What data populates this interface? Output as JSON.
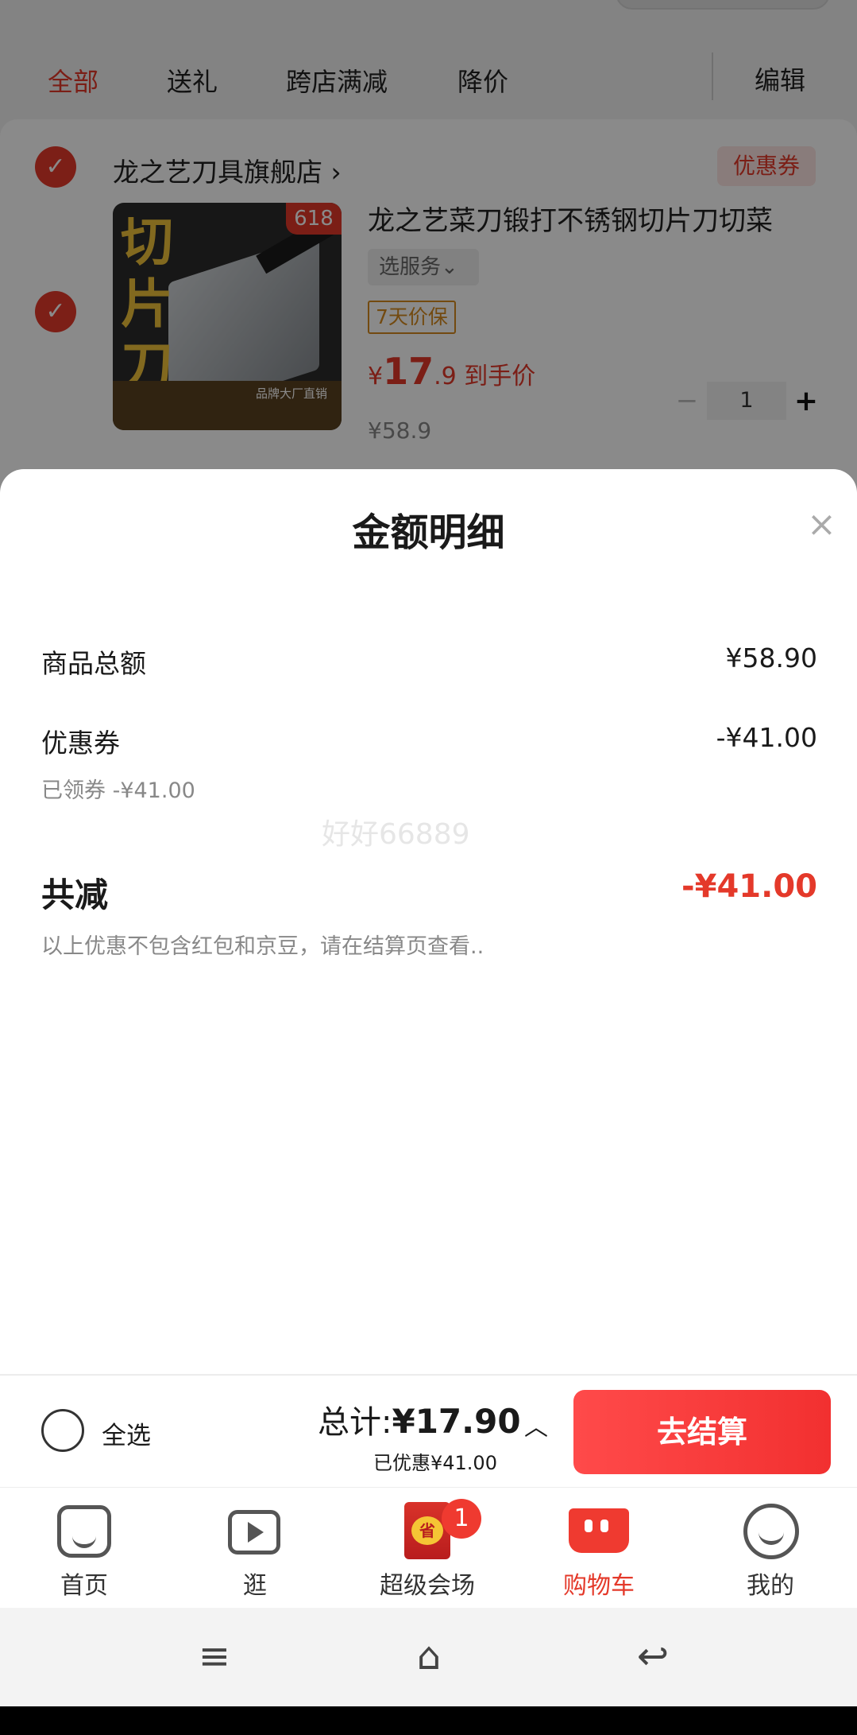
{
  "filters": {
    "tabs": [
      "全部",
      "送礼",
      "跨店满减",
      "降价"
    ],
    "edit_label": "编辑"
  },
  "shop": {
    "name": "龙之艺刀具旗舰店 ›",
    "coupon_tag": "优惠券"
  },
  "product": {
    "title": "龙之艺菜刀锻打不锈钢切片刀切菜",
    "image_badge": "618",
    "image_text": "切片刀",
    "image_strip": "品牌大厂直销",
    "service_select": "选服务⌄",
    "warranty_tag": "7天价保",
    "price_symbol": "¥",
    "price_int": "17",
    "price_dec": ".9",
    "price_suffix": "到手价",
    "original_price": "¥58.9",
    "quantity": "1",
    "minus": "−",
    "plus": "+"
  },
  "sheet": {
    "title": "金额明细",
    "close": "×",
    "goods_total_label": "商品总额",
    "goods_total_value": "¥58.90",
    "coupon_label": "优惠券",
    "coupon_value": "-¥41.00",
    "coupon_note": "已领券 -¥41.00",
    "watermark": "好好66889",
    "total_reduce_label": "共减",
    "total_reduce_value": "-¥41.00",
    "disclaimer": "以上优惠不包含红包和京豆，请在结算页查看.."
  },
  "checkout": {
    "select_all": "全选",
    "total_prefix": "总计:",
    "total_value": "¥17.90",
    "saved": "已优惠¥41.00",
    "chevron": "︿",
    "go_button": "去结算"
  },
  "tabbar": {
    "items": [
      {
        "label": "首页"
      },
      {
        "label": "逛"
      },
      {
        "label": "超级会场",
        "badge": "1"
      },
      {
        "label": "购物车"
      },
      {
        "label": "我的"
      }
    ],
    "active_color": "#e4392a"
  },
  "sysnav": {
    "menu": "≡",
    "home": "⌂",
    "back": "↩"
  },
  "colors": {
    "accent": "#e4392a",
    "checkout_button": "#f23030"
  }
}
